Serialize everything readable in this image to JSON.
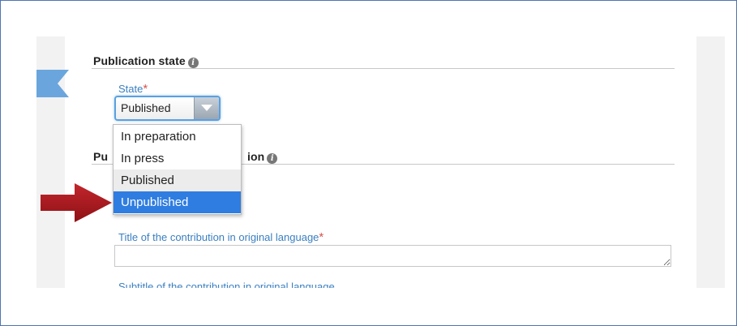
{
  "publication_state": {
    "title": "Publication state",
    "info_icon": "info-icon",
    "state_label": "State",
    "required_mark": "*",
    "selected_value": "Published",
    "options": [
      "In preparation",
      "In press",
      "Published",
      "Unpublished"
    ]
  },
  "second_section": {
    "title_left": "Pu",
    "title_right": "ion"
  },
  "title_field": {
    "label": "Title of the contribution in original language",
    "required_mark": "*",
    "value": ""
  },
  "subtitle_field": {
    "label_partial": "Subtitle of the contribution in original language"
  },
  "colors": {
    "accent": "#3a7fc1",
    "highlight": "#2f7de1",
    "arrow": "#a5151b",
    "required": "#d9534f"
  }
}
